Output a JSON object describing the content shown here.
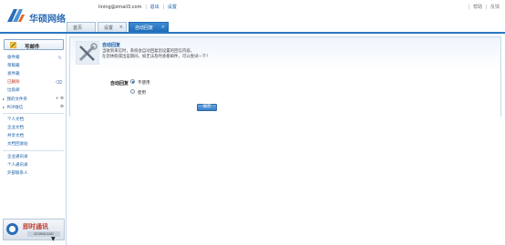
{
  "brand": {
    "name": "华硕网络"
  },
  "header": {
    "email": "lining@zmail3.com",
    "links": [
      "退出",
      "设置"
    ],
    "right_links": [
      "帮助",
      "反馈"
    ]
  },
  "tabs": [
    {
      "label": "首页"
    },
    {
      "label": "设置"
    },
    {
      "label": "自动回复"
    }
  ],
  "sidebar": {
    "compose_label": "写邮件",
    "mail_items": [
      {
        "label": "收件箱"
      },
      {
        "label": "草稿箱"
      },
      {
        "label": "发件箱"
      },
      {
        "label": "已删除"
      },
      {
        "label": "垃圾邮"
      }
    ],
    "folders_label": "我的文件夹",
    "pop_label": "POP收信",
    "doc_items": [
      {
        "label": "个人文档"
      },
      {
        "label": "企业文档"
      },
      {
        "label": "共享文档"
      },
      {
        "label": "文档回收站"
      }
    ],
    "contact_items": [
      {
        "label": "企业通讯录"
      },
      {
        "label": "个人通讯录"
      },
      {
        "label": "外部联系人"
      }
    ],
    "im": {
      "title": "即时通讯",
      "download": "DOWNLOAD"
    }
  },
  "main": {
    "section_title": "自动回复",
    "description_lines": [
      "当收到来信时，系统会自动回复您设置的回信内容。",
      "在您休假或出差期间，如无法及时查看邮件，可以尝试一下！"
    ],
    "form_label": "自动回复",
    "options": [
      "不使用",
      "使用"
    ],
    "selected_option": "不使用",
    "save_label": "保存"
  },
  "colors": {
    "accent": "#2a78c4",
    "link": "#1a5fa8",
    "active_tab": "#1f6cb8",
    "alert_red": "#c0392b"
  }
}
